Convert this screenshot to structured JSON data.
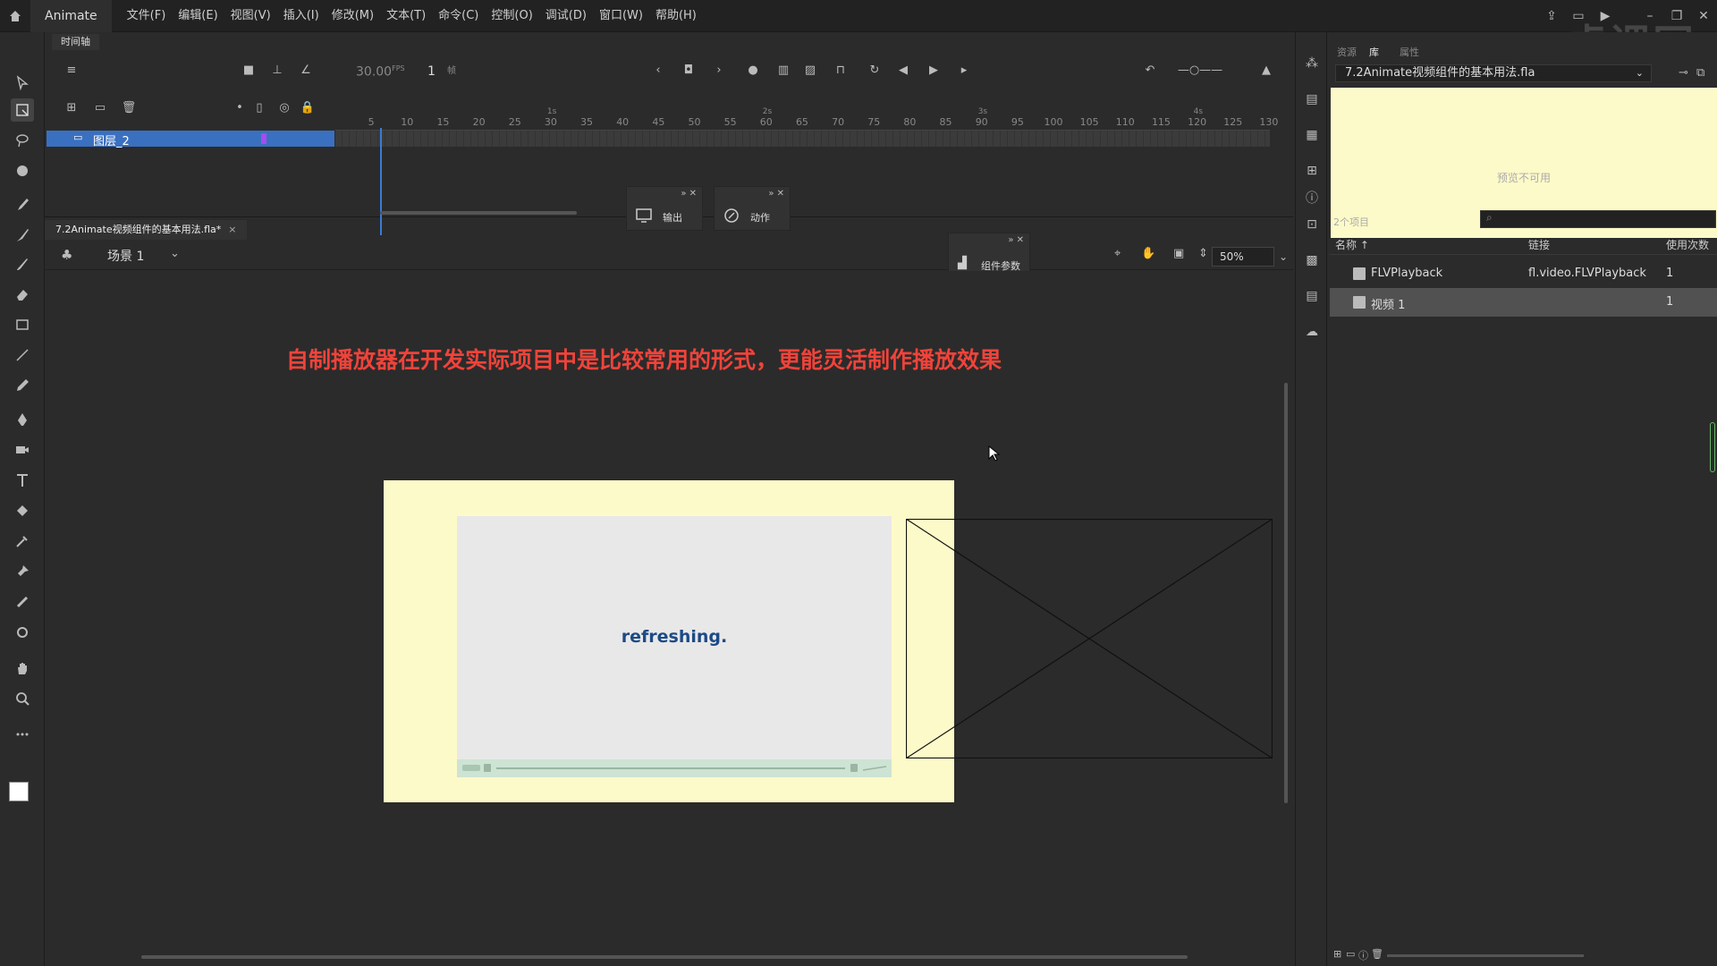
{
  "app": {
    "name": "Animate",
    "menu": [
      "文件(F)",
      "编辑(E)",
      "视图(V)",
      "插入(I)",
      "修改(M)",
      "文本(T)",
      "命令(C)",
      "控制(O)",
      "调试(D)",
      "窗口(W)",
      "帮助(H)"
    ],
    "watermark": "虎课网"
  },
  "timeline": {
    "tab_label": "时间轴",
    "fps": "30.00",
    "fps_unit": "FPS",
    "current_frame": "1",
    "frame_unit": "帧",
    "layer_name": "图层_2",
    "ruler_ticks": [
      "5",
      "10",
      "15",
      "20",
      "25",
      "30",
      "35",
      "40",
      "45",
      "50",
      "55",
      "60",
      "65",
      "70",
      "75",
      "80",
      "85",
      "90",
      "95",
      "100",
      "105",
      "110",
      "115",
      "120",
      "125",
      "130"
    ],
    "ruler_seconds": [
      "1s",
      "2s",
      "3s",
      "4s"
    ],
    "output_panel": "输出",
    "actions_panel": "动作"
  },
  "document": {
    "tab_label": "7.2Animate视频组件的基本用法.fla*",
    "scene_label": "场景 1",
    "zoom": "50%",
    "component_params": "组件参数"
  },
  "stage": {
    "caption": "自制播放器在开发实际项目中是比较常用的形式，更能灵活制作播放效果",
    "player_text": "refreshing."
  },
  "library": {
    "tabs": [
      "资源",
      "库",
      "属性"
    ],
    "document_select": "7.2Animate视频组件的基本用法.fla",
    "preview_text": "预览不可用",
    "item_count": "2个项目",
    "columns": {
      "name": "名称 ↑",
      "linkage": "链接",
      "use_count": "使用次数"
    },
    "items": [
      {
        "name": "FLVPlayback",
        "linkage": "fl.video.FLVPlayback",
        "use_count": "1"
      },
      {
        "name": "视频 1",
        "linkage": "",
        "use_count": "1"
      }
    ]
  },
  "colors": {
    "caption": "#f0433a",
    "stage_bg": "#fdfac9",
    "selection": "#3a70c0",
    "player_text": "#1d4a86"
  }
}
